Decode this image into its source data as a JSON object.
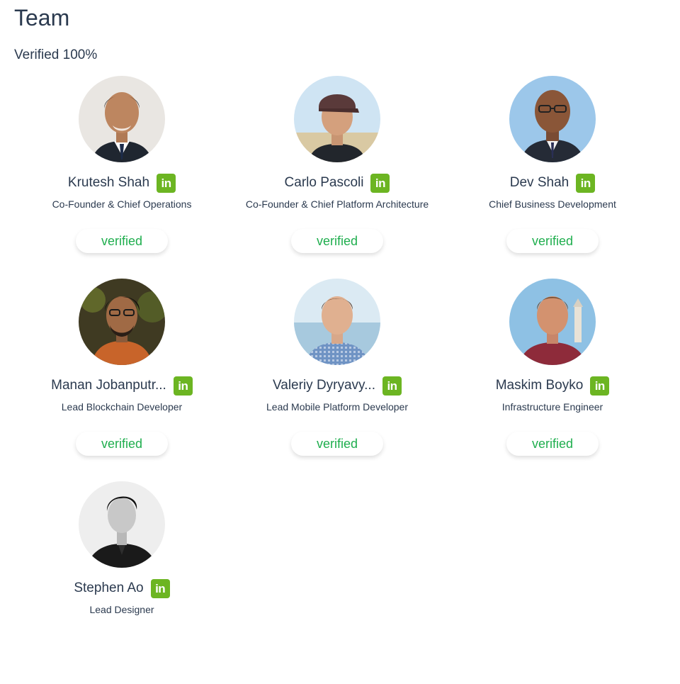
{
  "page": {
    "title": "Team",
    "verified_summary": "Verified 100%"
  },
  "colors": {
    "linkedin": "#6cb522",
    "verified_text": "#1fae4e",
    "text": "#2b3a4f"
  },
  "linkedin_icon_text": "in",
  "members": [
    {
      "name": "Krutesh Shah",
      "role": "Co-Founder & Chief Operations",
      "verified": "verified",
      "icon": "linkedin-icon"
    },
    {
      "name": "Carlo Pascoli",
      "role": "Co-Founder & Chief Platform Architecture",
      "verified": "verified",
      "icon": "linkedin-icon"
    },
    {
      "name": "Dev Shah",
      "role": "Chief Business Development",
      "verified": "verified",
      "icon": "linkedin-icon"
    },
    {
      "name": "Manan Jobanputr...",
      "role": "Lead Blockchain Developer",
      "verified": "verified",
      "icon": "linkedin-icon"
    },
    {
      "name": "Valeriy Dyryavy...",
      "role": "Lead Mobile Platform Developer",
      "verified": "verified",
      "icon": "linkedin-icon"
    },
    {
      "name": "Maskim Boyko",
      "role": "Infrastructure Engineer",
      "verified": "verified",
      "icon": "linkedin-icon"
    },
    {
      "name": "Stephen Ao",
      "role": "Lead Designer",
      "icon": "linkedin-icon"
    }
  ]
}
